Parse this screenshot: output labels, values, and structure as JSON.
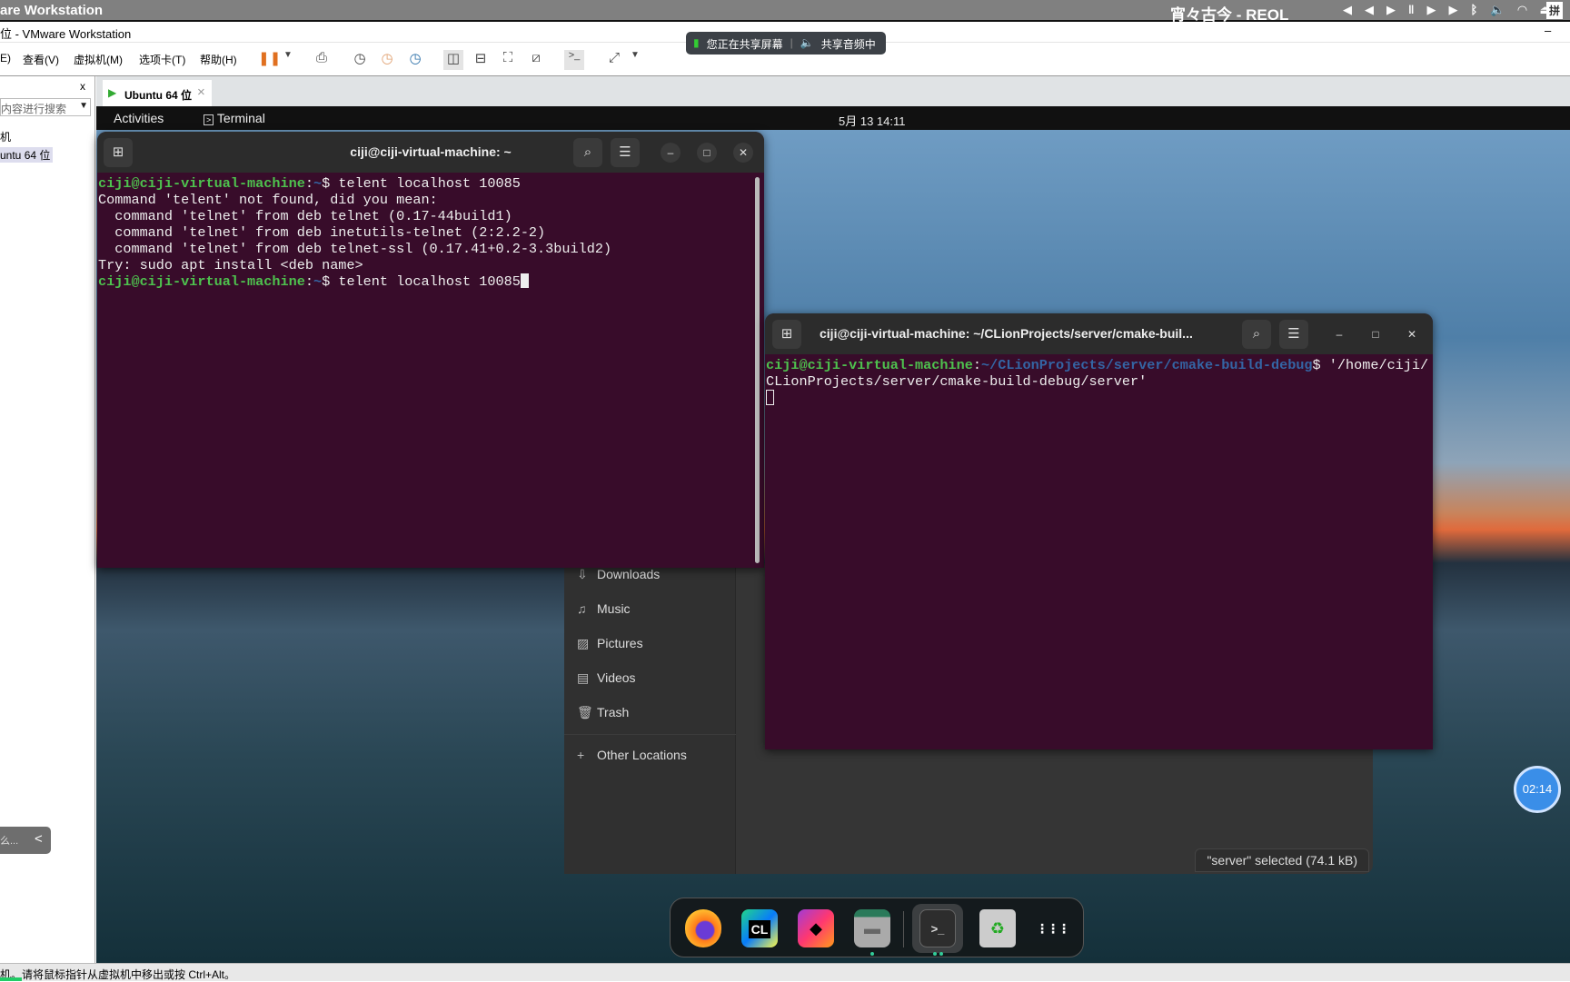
{
  "host": {
    "app_title": "are Workstation",
    "now_playing": "宵々古今 - REOL",
    "media_icons": [
      "rewind-icon",
      "play-pause-icon",
      "fast-forward-icon",
      "bluetooth-icon",
      "volume-icon",
      "wifi-icon",
      "eject-icon",
      "ime-icon"
    ],
    "ime_label": "拼"
  },
  "vmware": {
    "window_title": "位 - VMware Workstation",
    "minimize": "–",
    "menu": [
      "E)",
      "查看(V)",
      "虚拟机(M)",
      "选项卡(T)",
      "帮助(H)"
    ],
    "sharing": {
      "screen": "您正在共享屏幕",
      "audio": "共享音频中"
    },
    "library": {
      "close": "x",
      "search_placeholder": "内容进行搜索",
      "items": [
        "机",
        "untu 64 位"
      ],
      "collapsed_label": "么...",
      "collapse": "<"
    },
    "tab": {
      "label": "Ubuntu 64 位",
      "close": "×"
    },
    "status": "机。请将鼠标指针从虚拟机中移出或按 Ctrl+Alt。"
  },
  "ubuntu": {
    "activities": "Activities",
    "app": "Terminal",
    "clock": "5月 13  14:11",
    "timer": "02:14"
  },
  "terminal1": {
    "title": "ciji@ciji-virtual-machine: ~",
    "lines": [
      {
        "prompt": "ciji@ciji-virtual-machine",
        "path": "~",
        "cmd": "$ telent localhost 10085"
      },
      {
        "text": "Command 'telent' not found, did you mean:"
      },
      {
        "text": "  command 'telnet' from deb telnet (0.17-44build1)"
      },
      {
        "text": "  command 'telnet' from deb inetutils-telnet (2:2.2-2)"
      },
      {
        "text": "  command 'telnet' from deb telnet-ssl (0.17.41+0.2-3.3build2)"
      },
      {
        "text": "Try: sudo apt install <deb name>"
      },
      {
        "prompt": "ciji@ciji-virtual-machine",
        "path": "~",
        "cmd": "$ telent localhost 10085"
      }
    ]
  },
  "terminal2": {
    "title": "ciji@ciji-virtual-machine: ~/CLionProjects/server/cmake-buil...",
    "prompt": "ciji@ciji-virtual-machine",
    "path": "~/CLionProjects/server/cmake-build-debug",
    "cmd": "$ '/home/ciji/",
    "cmd_cont": "CLionProjects/server/cmake-build-debug/server'"
  },
  "files": {
    "sidebar": [
      {
        "label": "Downloads",
        "icon": "download-icon"
      },
      {
        "label": "Music",
        "icon": "music-icon"
      },
      {
        "label": "Pictures",
        "icon": "pictures-icon"
      },
      {
        "label": "Videos",
        "icon": "videos-icon"
      },
      {
        "label": "Trash",
        "icon": "trash-icon"
      },
      {
        "label": "Other Locations",
        "icon": "plus-icon"
      }
    ],
    "status": "\"server\" selected  (74.1 kB)"
  },
  "dock": [
    {
      "name": "Firefox",
      "label": "🦊"
    },
    {
      "name": "CLion",
      "label": "CL"
    },
    {
      "name": "JetBrains Toolbox",
      "label": "◆"
    },
    {
      "name": "Files",
      "label": "▬"
    },
    {
      "name": "Terminal",
      "label": ">_"
    },
    {
      "name": "Trash",
      "label": "♻"
    },
    {
      "name": "Show Apps",
      "label": "⋮⋮⋮"
    }
  ]
}
